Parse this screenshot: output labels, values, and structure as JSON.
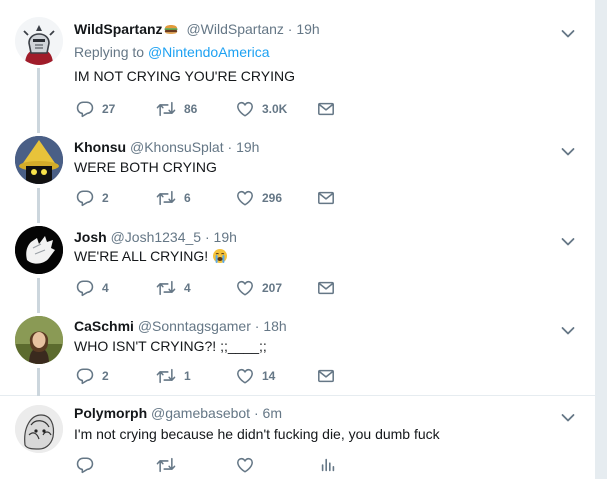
{
  "tweets": [
    {
      "name": "WildSpartanz",
      "handle": "@WildSpartanz",
      "dot": "·",
      "time": "19h",
      "name_emoji": "hamburger-emoji",
      "replying_prefix": "Replying to",
      "replying_to": "@NintendoAmerica",
      "text": "IM NOT CRYING YOU'RE CRYING",
      "replies": "27",
      "retweets": "86",
      "likes": "3.0K"
    },
    {
      "name": "Khonsu",
      "handle": "@KhonsuSplat",
      "dot": "·",
      "time": "19h",
      "text": "WERE BOTH CRYING",
      "replies": "2",
      "retweets": "6",
      "likes": "296"
    },
    {
      "name": "Josh",
      "handle": "@Josh1234_5",
      "dot": "·",
      "time": "19h",
      "text": "WE'RE ALL CRYING!",
      "text_emoji": "loudly-crying-face-emoji",
      "replies": "4",
      "retweets": "4",
      "likes": "207"
    },
    {
      "name": "CaSchmi",
      "handle": "@Sonntagsgamer",
      "dot": "·",
      "time": "18h",
      "text": "WHO ISN'T CRYING?! ;;____;;",
      "replies": "2",
      "retweets": "1",
      "likes": "14"
    },
    {
      "name": "Polymorph",
      "handle": "@gamebasebot",
      "dot": "·",
      "time": "6m",
      "text": "I'm not crying because he didn't fucking die, you dumb fuck",
      "replies": "",
      "retweets": "",
      "likes": ""
    }
  ],
  "colors": {
    "thread_line": "#ccd6dd",
    "link": "#1da1f2",
    "muted": "#657786",
    "text": "#14171a"
  },
  "icons": {
    "reply": "reply-icon",
    "retweet": "retweet-icon",
    "like": "heart-icon",
    "dm": "envelope-icon",
    "stats": "analytics-icon",
    "more": "chevron-down-icon"
  }
}
